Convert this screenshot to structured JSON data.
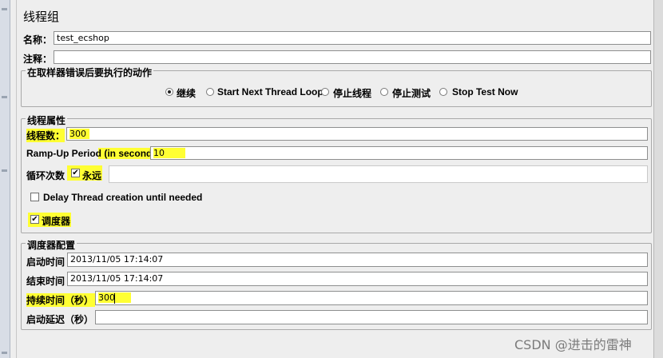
{
  "panel": {
    "title": "线程组"
  },
  "name_row": {
    "label": "名称：",
    "value": "test_ecshop"
  },
  "comment_row": {
    "label": "注释：",
    "value": ""
  },
  "error_action": {
    "legend": "在取样器错误后要执行的动作",
    "options": [
      "继续",
      "Start Next Thread Loop",
      "停止线程",
      "停止测试",
      "Stop Test Now"
    ],
    "selected": "继续"
  },
  "thread_props": {
    "legend": "线程属性",
    "threads_label": "线程数：",
    "threads_value": "300",
    "rampup_label": "Ramp-Up Period (in seconds):",
    "rampup_value": "10",
    "loop_label": "循环次数",
    "forever_label": "永远",
    "forever_checked": true,
    "delay_label": "Delay Thread creation until needed",
    "delay_checked": false,
    "scheduler_label": "调度器",
    "scheduler_checked": true
  },
  "scheduler_config": {
    "legend": "调度器配置",
    "start_label": "启动时间",
    "start_value": "2013/11/05 17:14:07",
    "end_label": "结束时间",
    "end_value": "2013/11/05 17:14:07",
    "duration_label": "持续时间（秒）",
    "duration_value": "300",
    "delay_label": "启动延迟（秒）",
    "delay_value": ""
  },
  "watermark": "CSDN @进击的雷神",
  "colors": {
    "highlight": "#ffff33",
    "background": "#eeeeee",
    "border": "#a9a9a9"
  }
}
